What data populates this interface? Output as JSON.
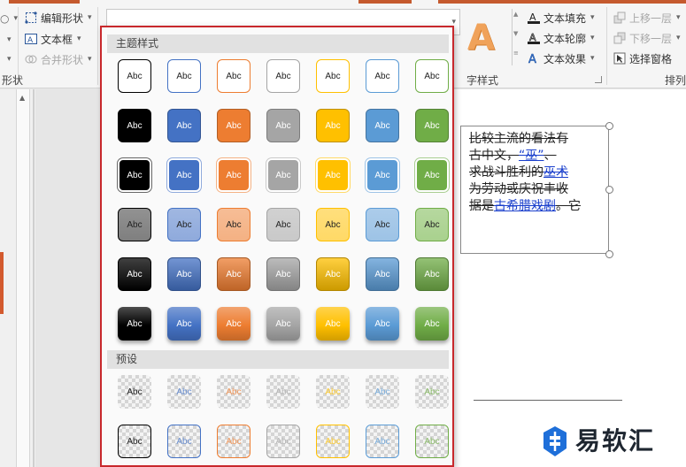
{
  "ribbon": {
    "edit_shape": "编辑形状",
    "text_box": "文本框",
    "merge_shapes": "合并形状",
    "shape_group_fragment": "形状",
    "wordart_group": "艺术字样式",
    "wordart_group_fragment": "字样式",
    "text_fill": "文本填充",
    "text_outline": "文本轮廓",
    "text_effect": "文本效果",
    "bring_forward": "上移一层",
    "send_backward": "下移一层",
    "selection_pane": "选择窗格",
    "arrange_group_fragment": "排列",
    "wordart_sample": "A"
  },
  "panel": {
    "theme_styles_label": "主题样式",
    "presets_label": "预设",
    "sample_text": "Abc"
  },
  "slide": {
    "line1_a": "比较主流的看法有",
    "line2_a": "古中文，",
    "line2_link": "“巫”",
    "line2_b": "、",
    "line3_a": "求战斗胜利的",
    "line3_link": "巫术",
    "line4_a": "为劳动或庆祝丰收",
    "line5_a": "据是",
    "line5_link": "古希腊戏剧",
    "line5_b": "。它"
  },
  "logo": {
    "text": "易软汇"
  },
  "colors": {
    "accent_red": "#c8282c",
    "theme": [
      "#000000",
      "#4472c4",
      "#ed7d31",
      "#a5a5a5",
      "#ffc000",
      "#5b9bd5",
      "#70ad47"
    ],
    "theme_light": [
      "#7f7f7f",
      "#8faadc",
      "#f4b183",
      "#c9c9c9",
      "#ffd966",
      "#9dc3e6",
      "#a9d18e"
    ]
  }
}
